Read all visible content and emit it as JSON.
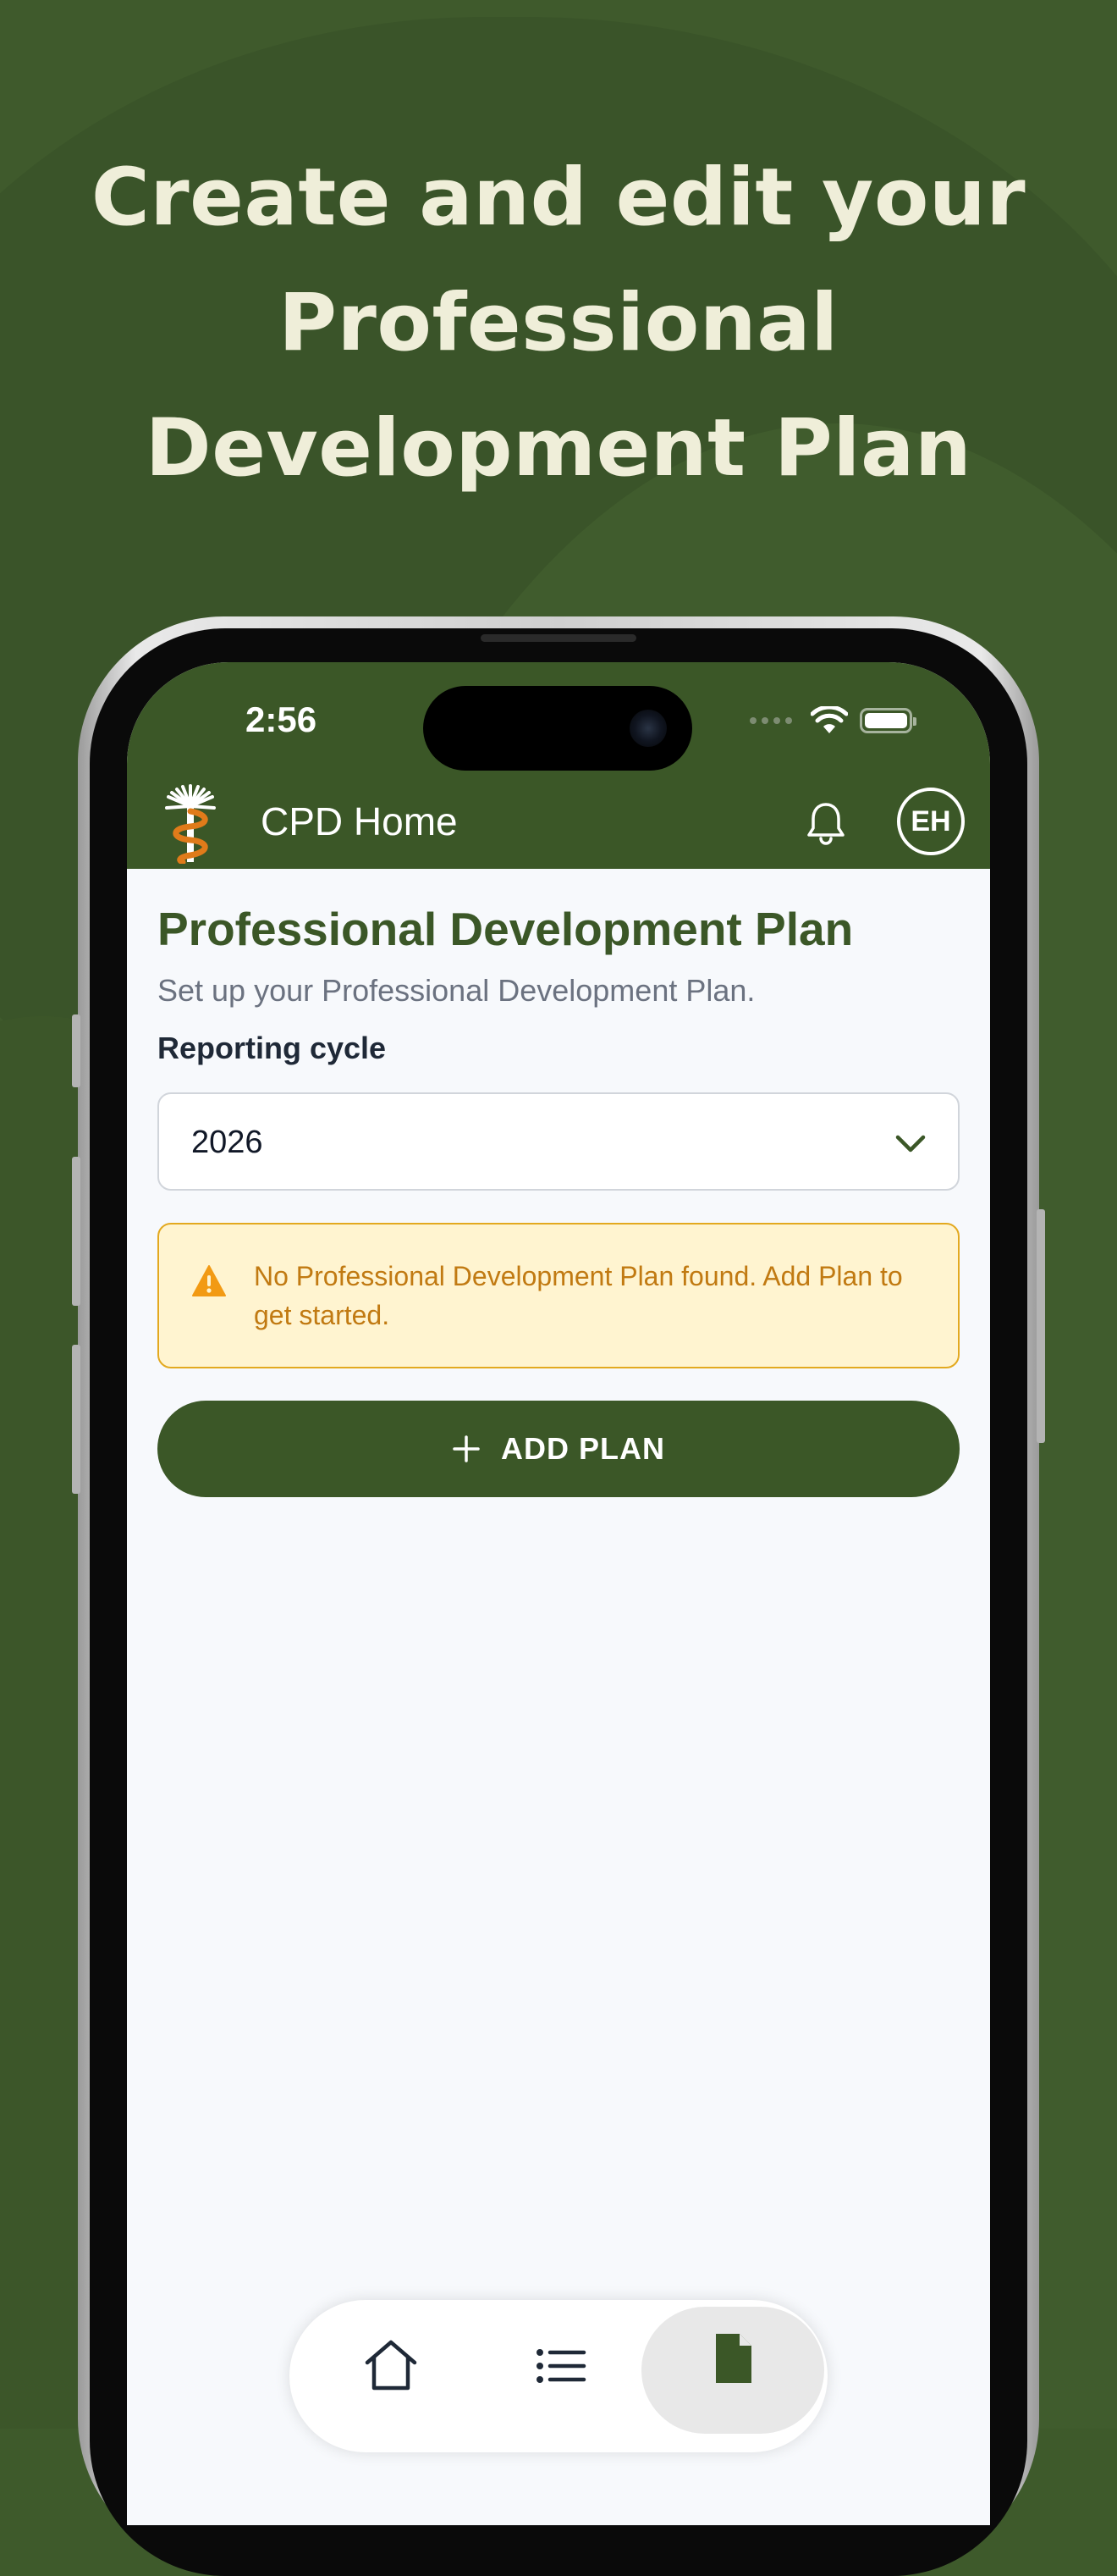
{
  "headline": "Create and edit your Professional Development Plan",
  "status_bar": {
    "time": "2:56"
  },
  "app_bar": {
    "title": "CPD Home",
    "avatar_initials": "EH",
    "logo_icon": "rod-of-asclepius-logo",
    "bell_icon": "bell-icon"
  },
  "page": {
    "title": "Professional Development Plan",
    "subtitle": "Set up your Professional Development Plan."
  },
  "reporting_cycle": {
    "label": "Reporting cycle",
    "selected": "2026"
  },
  "alert": {
    "message": "No Professional Development Plan found. Add Plan to get started.",
    "icon": "warning-icon"
  },
  "add_plan_button": {
    "label": "ADD PLAN",
    "icon": "plus-icon"
  },
  "tab_bar": {
    "tabs": [
      {
        "icon": "home-icon",
        "active": false
      },
      {
        "icon": "list-icon",
        "active": false
      },
      {
        "icon": "document-icon",
        "active": true
      }
    ]
  },
  "colors": {
    "brand_green": "#3b5727",
    "background_green": "#3f5a2c",
    "headline_cream": "#efeed9",
    "alert_background": "#fff4d0",
    "alert_border": "#e3a91f",
    "alert_text": "#c17a12",
    "logo_orange": "#e07b1a"
  }
}
